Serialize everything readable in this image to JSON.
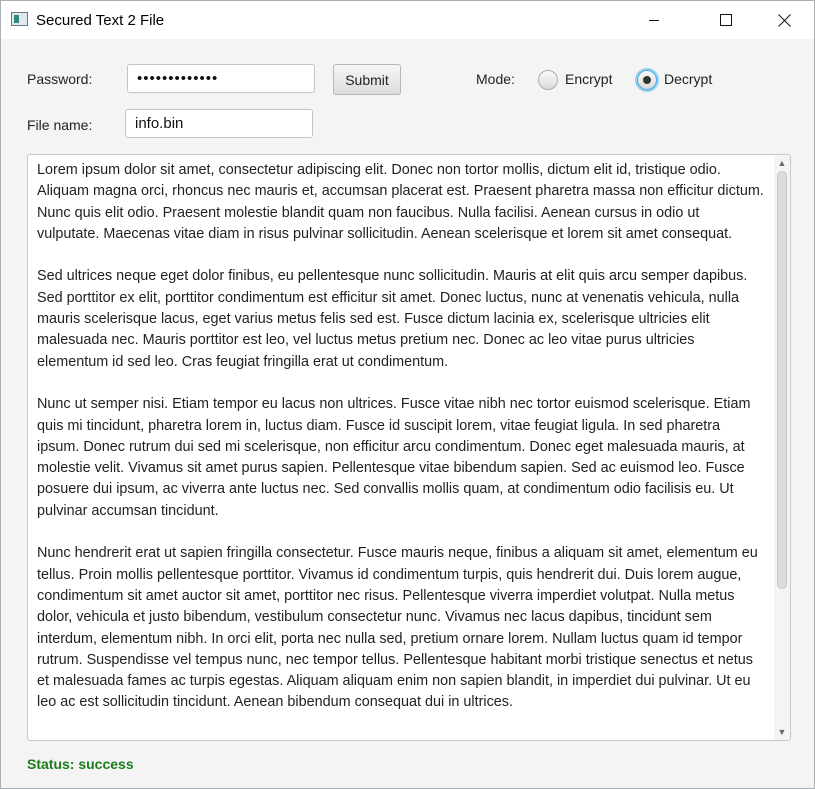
{
  "window": {
    "title": "Secured Text 2 File"
  },
  "form": {
    "password_label": "Password:",
    "password_value": "•••••••••••••",
    "submit_label": "Submit",
    "mode_label": "Mode:",
    "mode_options": [
      {
        "label": "Encrypt",
        "selected": false
      },
      {
        "label": "Decrypt",
        "selected": true
      }
    ],
    "filename_label": "File name:",
    "filename_value": "info.bin"
  },
  "content": {
    "text": "Lorem ipsum dolor sit amet, consectetur adipiscing elit. Donec non tortor mollis, dictum elit id, tristique odio. Aliquam magna orci, rhoncus nec mauris et, accumsan placerat est. Praesent pharetra massa non efficitur dictum. Nunc quis elit odio. Praesent molestie blandit quam non faucibus. Nulla facilisi. Aenean cursus in odio ut vulputate. Maecenas vitae diam in risus pulvinar sollicitudin. Aenean scelerisque et lorem sit amet consequat.\n\nSed ultrices neque eget dolor finibus, eu pellentesque nunc sollicitudin. Mauris at elit quis arcu semper dapibus. Sed porttitor ex elit, porttitor condimentum est efficitur sit amet. Donec luctus, nunc at venenatis vehicula, nulla mauris scelerisque lacus, eget varius metus felis sed est. Fusce dictum lacinia ex, scelerisque ultricies elit malesuada nec. Mauris porttitor est leo, vel luctus metus pretium nec. Donec ac leo vitae purus ultricies elementum id sed leo. Cras feugiat fringilla erat ut condimentum.\n\nNunc ut semper nisi. Etiam tempor eu lacus non ultrices. Fusce vitae nibh nec tortor euismod scelerisque. Etiam quis mi tincidunt, pharetra lorem in, luctus diam. Fusce id suscipit lorem, vitae feugiat ligula. In sed pharetra ipsum. Donec rutrum dui sed mi scelerisque, non efficitur arcu condimentum. Donec eget malesuada mauris, at molestie velit. Vivamus sit amet purus sapien. Pellentesque vitae bibendum sapien. Sed ac euismod leo. Fusce posuere dui ipsum, ac viverra ante luctus nec. Sed convallis mollis quam, at condimentum odio facilisis eu. Ut pulvinar accumsan tincidunt.\n\nNunc hendrerit erat ut sapien fringilla consectetur. Fusce mauris neque, finibus a aliquam sit amet, elementum eu tellus. Proin mollis pellentesque porttitor. Vivamus id condimentum turpis, quis hendrerit dui. Duis lorem augue, condimentum sit amet auctor sit amet, porttitor nec risus. Pellentesque viverra imperdiet volutpat. Nulla metus dolor, vehicula et justo bibendum, vestibulum consectetur nunc. Vivamus nec lacus dapibus, tincidunt sem interdum, elementum nibh. In orci elit, porta nec nulla sed, pretium ornare lorem. Nullam luctus quam id tempor rutrum. Suspendisse vel tempus nunc, nec tempor tellus. Pellentesque habitant morbi tristique senectus et netus et malesuada fames ac turpis egestas. Aliquam aliquam enim non sapien blandit, in imperdiet dui pulvinar. Ut eu leo ac est sollicitudin tincidunt. Aenean bibendum consequat dui in ultrices."
  },
  "status": {
    "text": "Status: success",
    "color": "#1d7a1d"
  }
}
